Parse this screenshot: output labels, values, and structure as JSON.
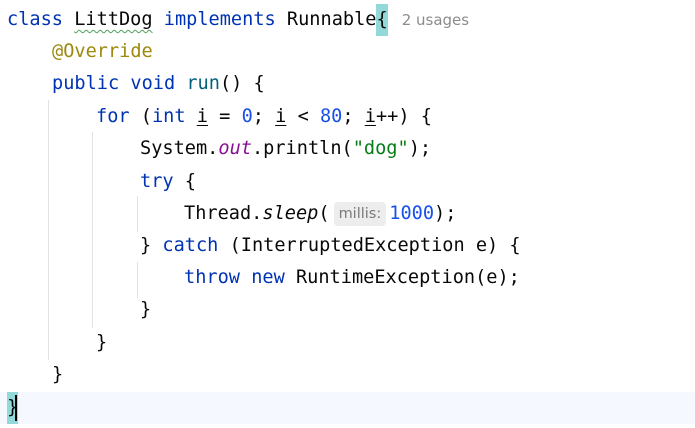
{
  "code": {
    "line1": {
      "kw_class": "class",
      "class_name": "LittDog",
      "kw_implements": "implements",
      "interface_name": "Runnable",
      "open_brace": "{",
      "usages_hint": "2 usages"
    },
    "line2": {
      "annotation": "@Override"
    },
    "line3": {
      "kw_public": "public",
      "kw_void": "void",
      "method_name": "run",
      "rest": "() {"
    },
    "line4": {
      "kw_for": "for",
      "p1": " (",
      "kw_int": "int",
      "var_i": "i",
      "p2": " = ",
      "num_zero": "0",
      "p3": "; ",
      "p4": " < ",
      "num_eighty": "80",
      "p5": "; ",
      "p6": "++) {"
    },
    "line5": {
      "prefix": "System.",
      "field_out": "out",
      "call": ".println(",
      "string_dog": "\"dog\"",
      "suffix": ");"
    },
    "line6": {
      "kw_try": "try",
      "rest": " {"
    },
    "line7": {
      "prefix": "Thread.",
      "method_sleep": "sleep",
      "paren": "(",
      "param_hint": "millis:",
      "num_value": "1000",
      "suffix": ");"
    },
    "line8": {
      "close": "} ",
      "kw_catch": "catch",
      "rest": " (InterruptedException e) {"
    },
    "line9": {
      "kw_throw": "throw",
      "kw_new": "new",
      "rest": " RuntimeException(e);"
    },
    "line10": {
      "brace": "}"
    },
    "line11": {
      "brace": "}"
    },
    "line12": {
      "brace": "}"
    },
    "line13": {
      "brace": "}"
    }
  }
}
